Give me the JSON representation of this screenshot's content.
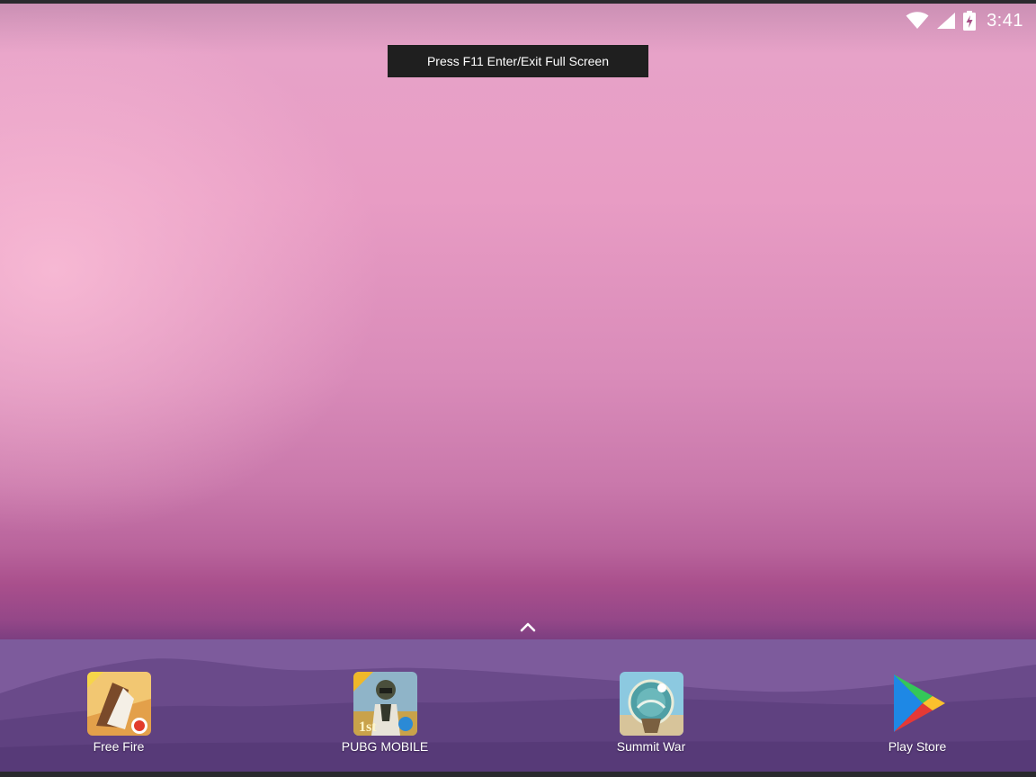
{
  "status_bar": {
    "time": "3:41",
    "icons": [
      "wifi-icon",
      "cellular-signal-icon",
      "battery-charging-icon"
    ]
  },
  "tooltip": {
    "text": "Press F11 Enter/Exit Full Screen"
  },
  "app_drawer": {
    "icon": "chevron-up-icon"
  },
  "dock": {
    "apps": [
      {
        "label": "Free Fire",
        "icon": "free-fire-app-icon"
      },
      {
        "label": "PUBG MOBILE",
        "icon": "pubg-mobile-app-icon"
      },
      {
        "label": "Summit War",
        "icon": "summit-war-app-icon"
      },
      {
        "label": "Play Store",
        "icon": "play-store-app-icon"
      }
    ]
  },
  "colors": {
    "wallpaper_top": "#e7a2c8",
    "wallpaper_bottom": "#7b3e80",
    "dock": "#7a5a98",
    "tooltip_bg": "#1f1f1f"
  }
}
